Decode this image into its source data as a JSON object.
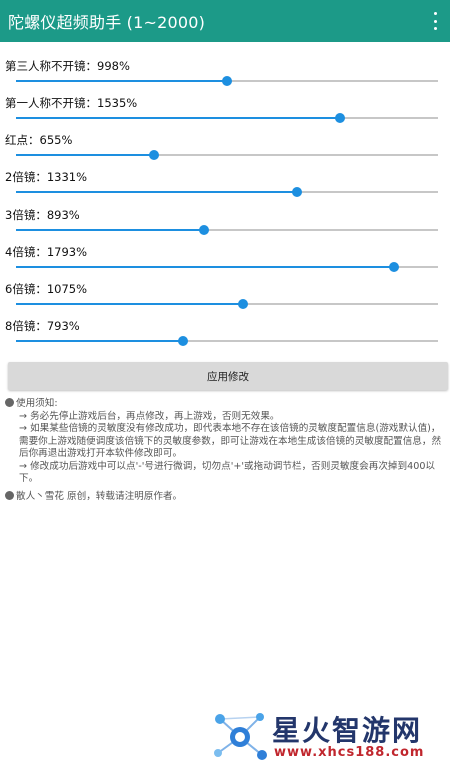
{
  "app": {
    "title": "陀螺仪超频助手 (1~2000)",
    "menu_icon": "more-vert-icon"
  },
  "sliders": [
    {
      "label": "第三人称不开镜：998%",
      "value": 998,
      "max": 2000
    },
    {
      "label": "第一人称不开镜：1535%",
      "value": 1535,
      "max": 2000
    },
    {
      "label": "红点：655%",
      "value": 655,
      "max": 2000
    },
    {
      "label": "2倍镜：1331%",
      "value": 1331,
      "max": 2000
    },
    {
      "label": "3倍镜：893%",
      "value": 893,
      "max": 2000
    },
    {
      "label": "4倍镜：1793%",
      "value": 1793,
      "max": 2000
    },
    {
      "label": "6倍镜：1075%",
      "value": 1075,
      "max": 2000
    },
    {
      "label": "8倍镜：793%",
      "value": 793,
      "max": 2000
    }
  ],
  "apply_button": "应用修改",
  "notes": {
    "heading": "使用须知:",
    "item1": "→ 务必先停止游戏后台，再点修改，再上游戏，否则无效果。",
    "item2": "→ 如果某些倍镜的灵敏度没有修改成功，即代表本地不存在该倍镜的灵敏度配置信息(游戏默认值)，需要你上游戏随便调度该倍镜下的灵敏度参数，即可让游戏在本地生成该倍镜的灵敏度配置信息，然后你再退出游戏打开本软件修改即可。",
    "item3": "→ 修改成功后游戏中可以点'-'号进行微调，切勿点'+'或拖动调节栏，否则灵敏度会再次掉到400以下。",
    "credit": "散人丶雪花 原创，转载请注明原作者。"
  },
  "watermark": {
    "name": "星火智游网",
    "url": "www.xhcs188.com"
  },
  "colors": {
    "appbar": "#1c9a88",
    "accent": "#1d8fe0"
  }
}
